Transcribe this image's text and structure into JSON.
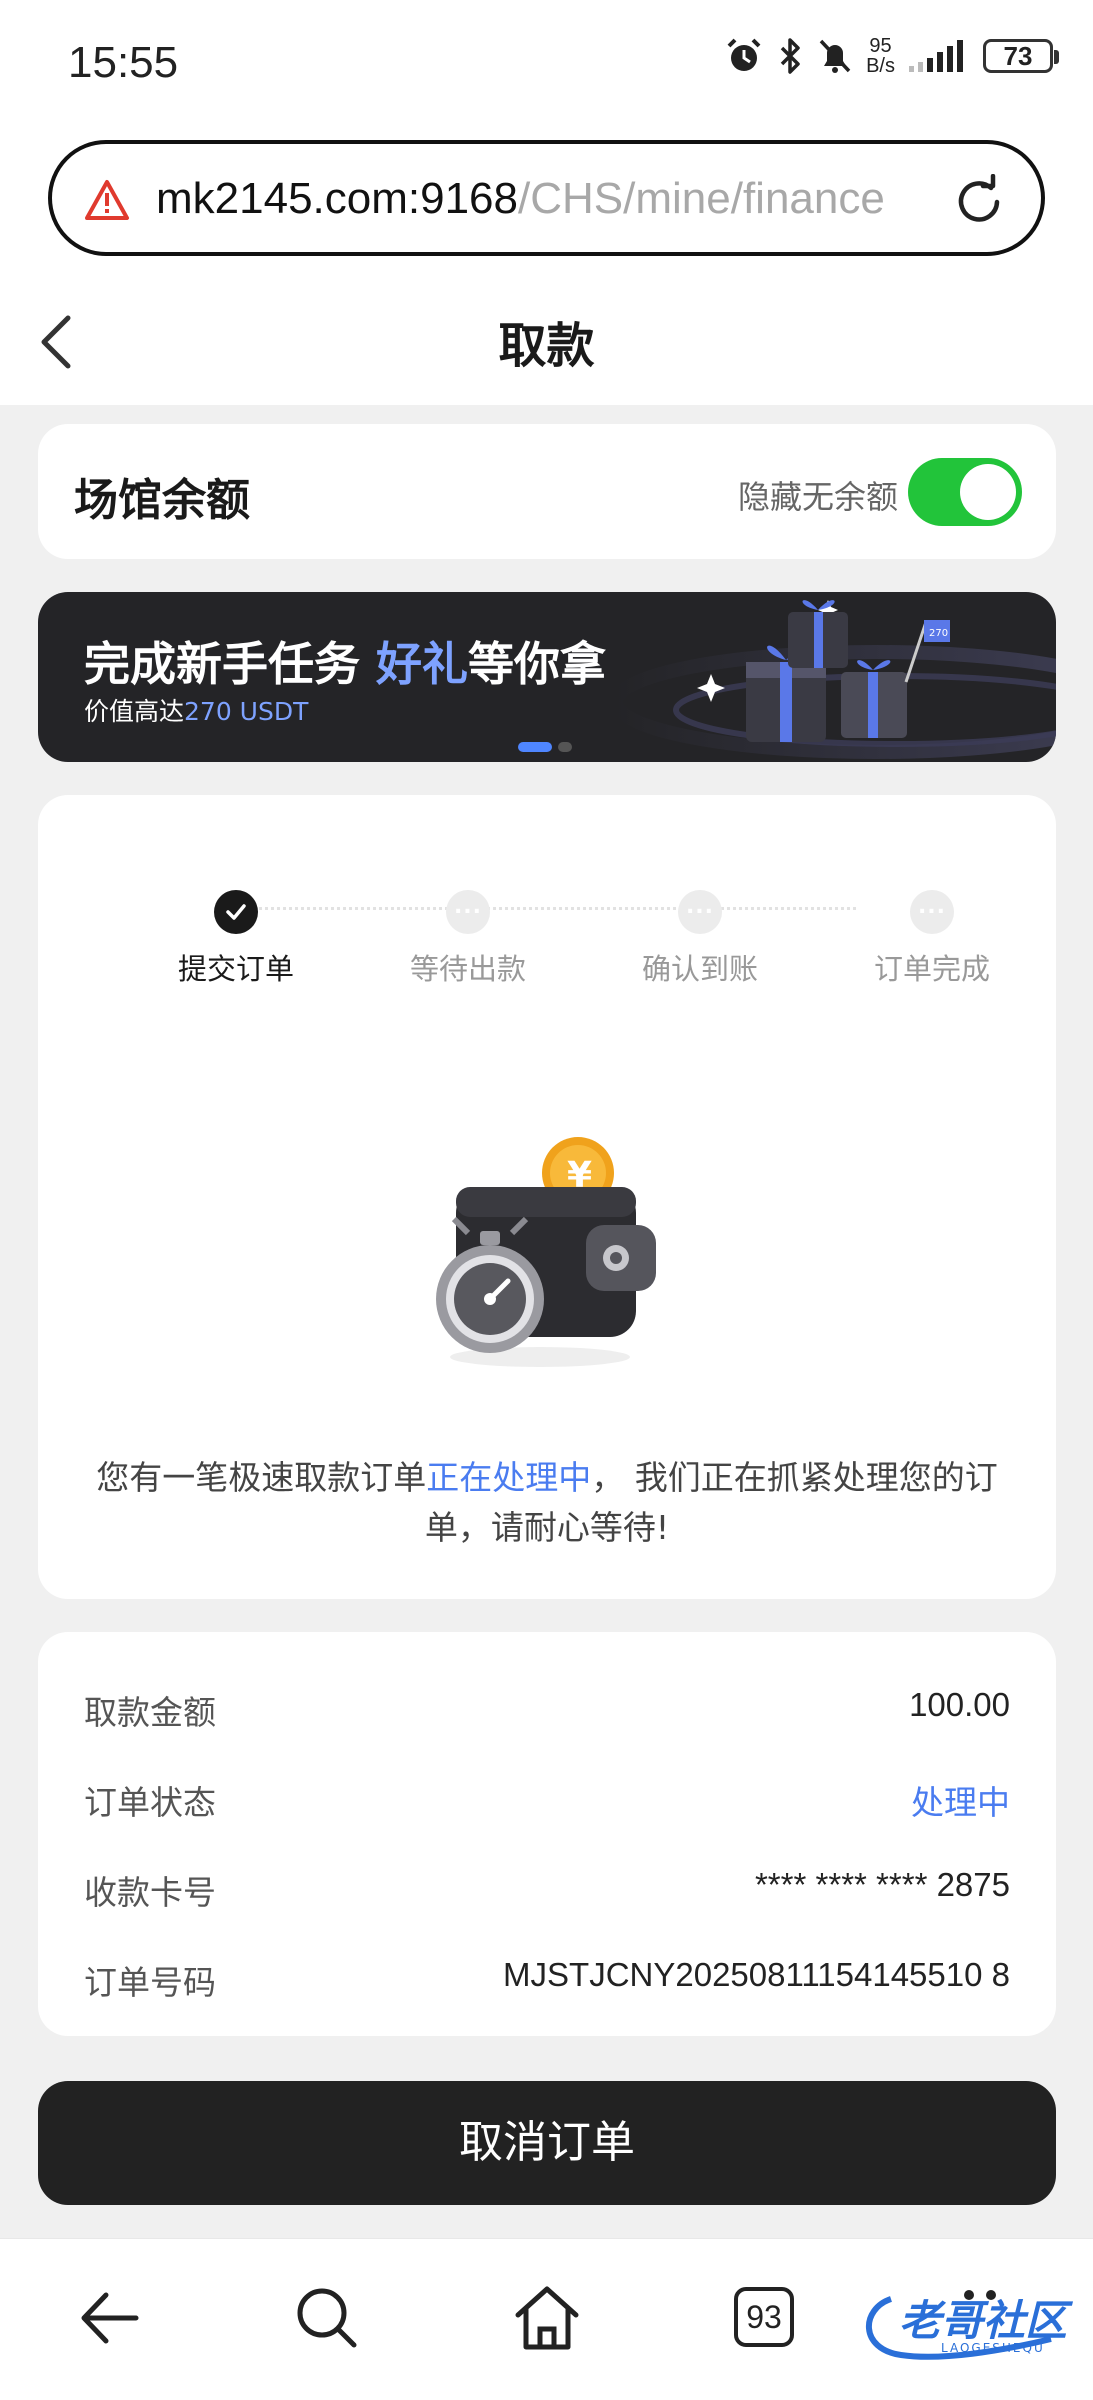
{
  "status_bar": {
    "time": "15:55",
    "net_speed_value": "95",
    "net_speed_unit": "B/s",
    "battery": "73"
  },
  "browser": {
    "url_host": "mk2145.com:9168",
    "url_path": "/CHS/mine/finance",
    "tab_count": "93"
  },
  "header": {
    "title": "取款"
  },
  "balance": {
    "label": "场馆余额",
    "hide_label": "隐藏无余额",
    "toggle_on": true
  },
  "banner": {
    "headline_pre": "完成新手任务 ",
    "headline_highlight": "好礼",
    "headline_post": "等你拿",
    "sub_pre": "价值高达",
    "sub_highlight": "270 USDT",
    "badge": "270"
  },
  "progress": {
    "steps": [
      {
        "label": "提交订单",
        "done": true
      },
      {
        "label": "等待出款",
        "done": false
      },
      {
        "label": "确认到账",
        "done": false
      },
      {
        "label": "订单完成",
        "done": false
      }
    ],
    "coin_symbol": "¥",
    "notice_pre": "您有一笔极速取款订单",
    "notice_highlight": "正在处理中",
    "notice_post": "， 我们正在抓紧处理您的订单，请耐心等待!"
  },
  "details": {
    "amount_label": "取款金额",
    "amount_value": "100.00",
    "status_label": "订单状态",
    "status_value": "处理中",
    "card_label": "收款卡号",
    "card_value": "**** **** **** 2875",
    "order_label": "订单号码",
    "order_value": "MJSTJCNY20250811154145510 8"
  },
  "cancel_button": "取消订单",
  "watermark": {
    "text": "老哥社区",
    "sub": "LAOGESHEQU"
  },
  "colors": {
    "accent_blue": "#4a7cf0",
    "toggle_green": "#22c43a",
    "dark": "#222222"
  }
}
